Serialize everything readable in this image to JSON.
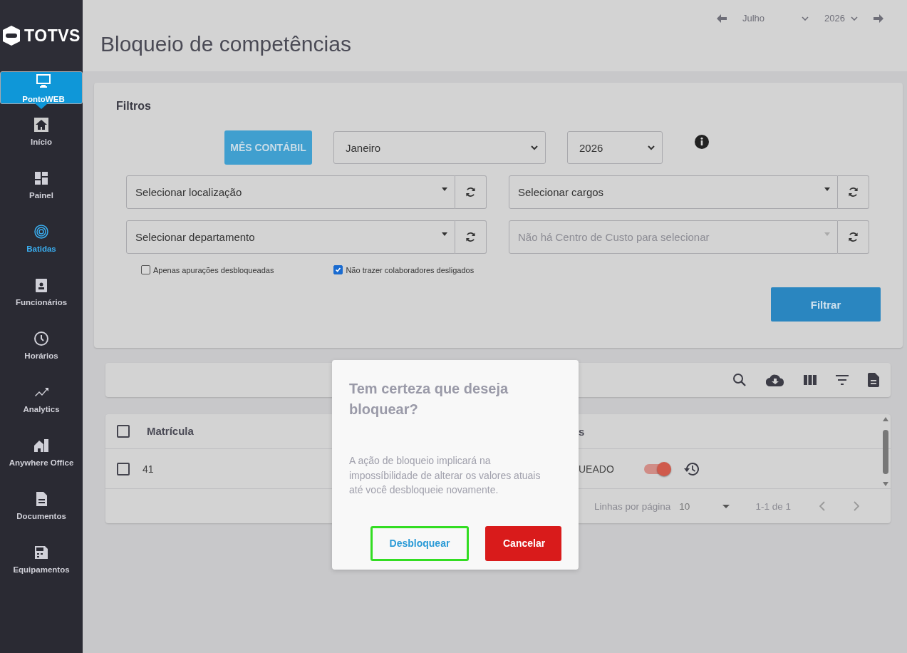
{
  "sidebar": {
    "logo": "TOTVS",
    "items": [
      {
        "label": "PontoWEB",
        "selected": true,
        "current": false
      },
      {
        "label": "Início",
        "selected": false,
        "current": false
      },
      {
        "label": "Painel",
        "selected": false,
        "current": false
      },
      {
        "label": "Batidas",
        "selected": false,
        "current": true
      },
      {
        "label": "Funcionários",
        "selected": false,
        "current": false
      },
      {
        "label": "Horários",
        "selected": false,
        "current": false
      },
      {
        "label": "Analytics",
        "selected": false,
        "current": false
      },
      {
        "label": "Anywhere Office",
        "selected": false,
        "current": false
      },
      {
        "label": "Documentos",
        "selected": false,
        "current": false
      },
      {
        "label": "Equipamentos",
        "selected": false,
        "current": false
      }
    ]
  },
  "header": {
    "month": "Julho",
    "year": "2026",
    "title": "Bloqueio de competências"
  },
  "filters": {
    "title": "Filtros",
    "period_button": "MÊS CONTÁBIL",
    "month": "Janeiro",
    "year": "2026",
    "selects": [
      {
        "placeholder": "Selecionar localização",
        "disabled": false
      },
      {
        "placeholder": "Selecionar cargos",
        "disabled": false
      },
      {
        "placeholder": "Selecionar departamento",
        "disabled": false
      },
      {
        "placeholder": "Não há Centro de Custo para selecionar",
        "disabled": true
      }
    ],
    "checkboxes": [
      {
        "label": "Apenas apurações desbloqueadas",
        "checked": false
      },
      {
        "label": "Não trazer colaboradores desligados",
        "checked": true
      }
    ],
    "filter_button": "Filtrar"
  },
  "table": {
    "header_checked": false,
    "columns": [
      {
        "label": "Matrícula"
      },
      {
        "label": "s"
      }
    ],
    "rows": [
      {
        "checked": false,
        "matricula": "41",
        "status": "UEADO",
        "on": true
      }
    ],
    "footer": {
      "rows_per_page_label": "Linhas por página",
      "rows_per_page": "10",
      "range": "1-1 de 1"
    }
  },
  "dialog": {
    "title": "Tem certeza que deseja bloquear?",
    "message": "A ação de bloqueio implicará na impossíbilidade de alterar os valores atuais até você desbloqueie novamente.",
    "buttons": [
      {
        "label": "Desbloquear",
        "kind": "outline",
        "focused": true
      },
      {
        "label": "Cancelar",
        "kind": "danger",
        "focused": false
      }
    ]
  }
}
